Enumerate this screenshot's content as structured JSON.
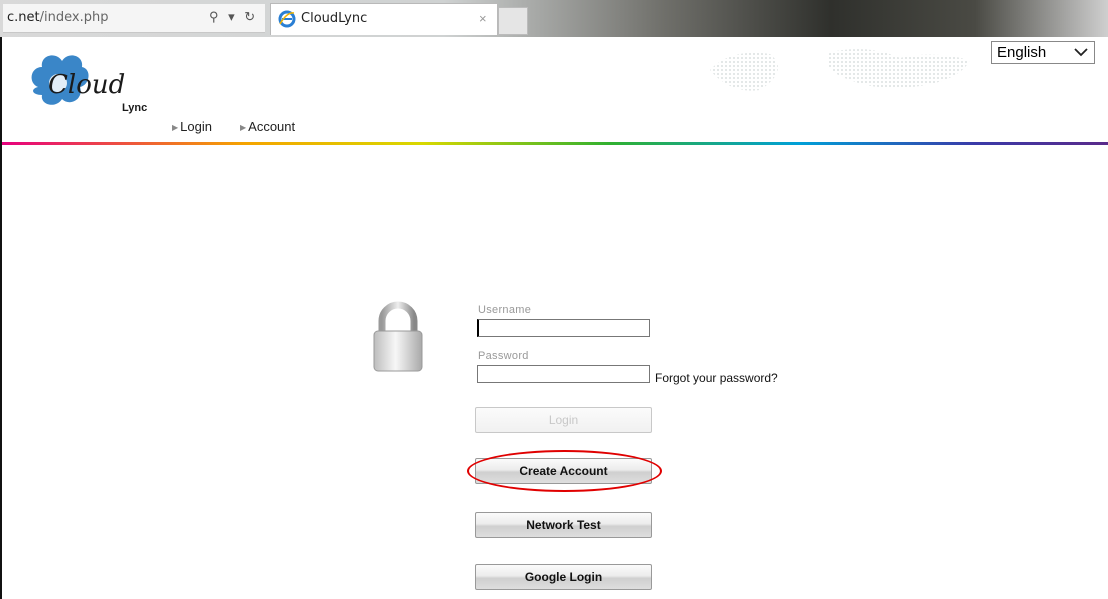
{
  "browser": {
    "url_domain": "c.net",
    "url_path": "/index.php",
    "tab_title": "CloudLync",
    "tab_close": "×",
    "addr_controls": "⚲ ▾ ↻"
  },
  "header": {
    "logo_text": "Cloud",
    "logo_sub": "Lync",
    "nav": [
      {
        "label": "Login"
      },
      {
        "label": "Account"
      }
    ],
    "language": "English"
  },
  "login": {
    "username_label": "Username",
    "username_value": "",
    "password_label": "Password",
    "password_value": "",
    "forgot_label": "Forgot your password?",
    "login_button": "Login",
    "create_account_button": "Create Account",
    "network_test_button": "Network Test",
    "google_login_button": "Google Login"
  },
  "colors": {
    "highlight": "#e00000",
    "logo_cloud": "#3a86c8"
  }
}
